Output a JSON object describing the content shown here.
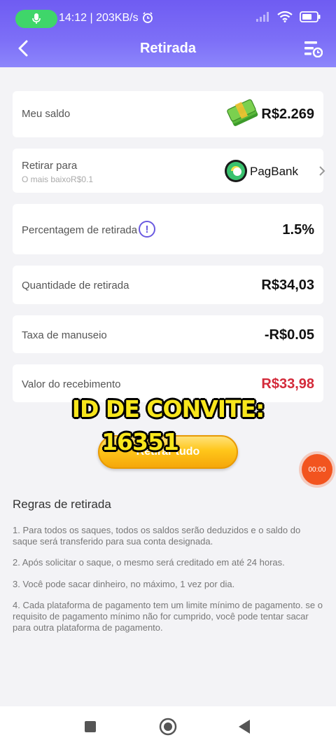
{
  "status_bar": {
    "time_speed": "14:12 | 203KB/s"
  },
  "header": {
    "title": "Retirada"
  },
  "balance": {
    "label": "Meu saldo",
    "value": "R$2.269"
  },
  "withdraw_to": {
    "label": "Retirar para",
    "sublabel": "O mais baixoR$0.1",
    "provider": "PagBank"
  },
  "percentage": {
    "label": "Percentagem de retirada",
    "info_glyph": "!",
    "value": "1.5%"
  },
  "quantity": {
    "label": "Quantidade de retirada",
    "value": "R$34,03"
  },
  "fee": {
    "label": "Taxa de manuseio",
    "value": "-R$0.05"
  },
  "received": {
    "label": "Valor do recebimento",
    "value": "R$33,98",
    "color": "#d32a3a"
  },
  "overlay": {
    "line1": "ID DE CONVITE:",
    "line2": "16351"
  },
  "withdraw_button": {
    "label": "Retirar tudo"
  },
  "record_button": {
    "label": "00:00"
  },
  "rules": {
    "title": "Regras de retirada",
    "items": [
      "1. Para todos os saques, todos os saldos serão deduzidos e o saldo do saque será transferido para sua conta designada.",
      "2. Após solicitar o saque, o mesmo será creditado em até 24 horas.",
      "3. Você pode sacar dinheiro, no máximo, 1 vez por dia.",
      "4. Cada plataforma de pagamento tem um limite mínimo de pagamento. se o requisito de pagamento mínimo não for cumprido, você pode tentar sacar para outra plataforma de pagamento."
    ]
  },
  "colors": {
    "header_accent": "#6f5cf2",
    "button": "#ffc61a",
    "overlay_text": "#f8e61c"
  }
}
